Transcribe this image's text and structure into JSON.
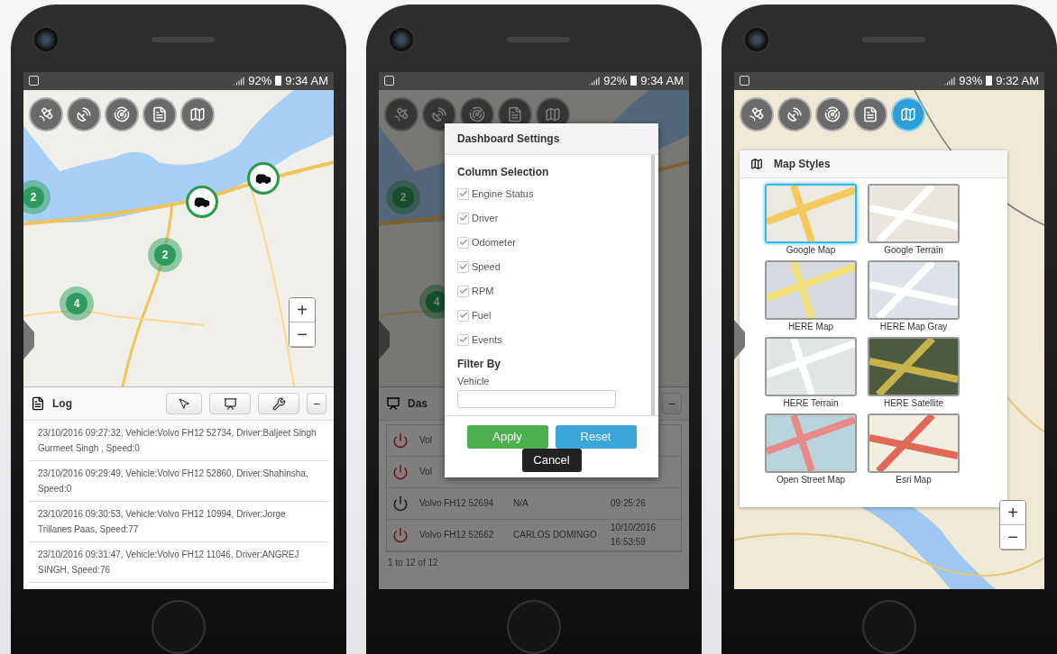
{
  "phones": [
    {
      "kind": "log",
      "status": {
        "battery": "92%",
        "time": "9:34 AM"
      },
      "toolbar": [
        {
          "selected": false
        },
        {
          "selected": false
        },
        {
          "selected": false
        },
        {
          "selected": false
        },
        {
          "selected": false
        }
      ],
      "clusters": [
        "2",
        "2",
        "4"
      ],
      "zoom": {
        "in": "+",
        "out": "−"
      },
      "log": {
        "title": "Log",
        "minimize": "−",
        "entries": [
          "23/10/2016 09:27:32, Vehicle:Volvo FH12 52734, Driver:Baljeet Singh Gurmeet Singh , Speed:0",
          "23/10/2016 09:29:49, Vehicle:Volvo FH12 52860, Driver:Shahinsha, Speed:0",
          "23/10/2016 09:30:53, Vehicle:Volvo FH12 10994, Driver:Jorge Trillanes Paas, Speed:77",
          "23/10/2016 09:31:47, Vehicle:Volvo FH12 11046, Driver:ANGREJ SINGH, Speed:76"
        ]
      }
    },
    {
      "kind": "dashboard",
      "status": {
        "battery": "92%",
        "time": "9:34 AM"
      },
      "toolbar": [
        {
          "selected": false
        },
        {
          "selected": false
        },
        {
          "selected": false
        },
        {
          "selected": false
        },
        {
          "selected": false
        }
      ],
      "clusters": [
        "2",
        "4"
      ],
      "dashboard": {
        "title": "Das",
        "minimize": "−",
        "rows": [
          {
            "alert": true,
            "cells": [
              "Vol"
            ]
          },
          {
            "alert": true,
            "cells": [
              "Vol"
            ]
          },
          {
            "alert": false,
            "cells": [
              "Volvo FH12 52694",
              "N/A",
              "09:25:26"
            ]
          },
          {
            "alert": true,
            "cells": [
              "Volvo FH12 52662",
              "CARLOS DOMINGO",
              "10/10/2016 16:53:59"
            ]
          }
        ],
        "footer": "1 to 12 of 12"
      },
      "dialog": {
        "title": "Dashboard Settings",
        "section": "Column Selection",
        "columns": [
          {
            "label": "Engine Status",
            "checked": true
          },
          {
            "label": "Driver",
            "checked": true
          },
          {
            "label": "Odometer",
            "checked": true
          },
          {
            "label": "Speed",
            "checked": true
          },
          {
            "label": "RPM",
            "checked": true
          },
          {
            "label": "Fuel",
            "checked": true
          },
          {
            "label": "Events",
            "checked": true
          }
        ],
        "filter": "Filter By",
        "field_label": "Vehicle",
        "buttons": [
          {
            "label": "Apply",
            "kind": "apply"
          },
          {
            "label": "Reset",
            "kind": "reset"
          },
          {
            "label": "Cancel",
            "kind": "cancel"
          }
        ]
      }
    },
    {
      "kind": "styles",
      "status": {
        "battery": "93%",
        "time": "9:32 AM"
      },
      "toolbar": [
        {
          "selected": false
        },
        {
          "selected": false
        },
        {
          "selected": false
        },
        {
          "selected": false
        },
        {
          "selected": true
        }
      ],
      "zoom": {
        "in": "+",
        "out": "−"
      },
      "styles": {
        "title": "Map Styles",
        "items": [
          {
            "label": "Google Map",
            "selected": true
          },
          {
            "label": "Google Terrain",
            "selected": false
          },
          {
            "label": "HERE Map",
            "selected": false
          },
          {
            "label": "HERE Map Gray",
            "selected": false
          },
          {
            "label": "HERE Terrain",
            "selected": false
          },
          {
            "label": "HERE Satellite",
            "selected": false
          },
          {
            "label": "Open Street Map",
            "selected": false
          },
          {
            "label": "Esri Map",
            "selected": false
          }
        ]
      }
    }
  ]
}
